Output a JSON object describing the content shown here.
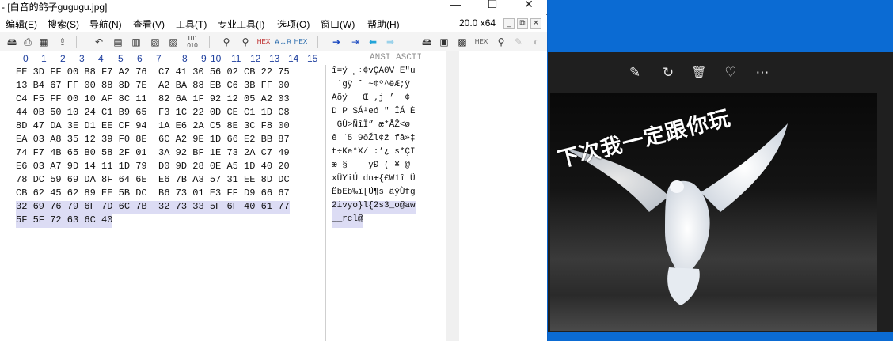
{
  "hexeditor": {
    "title": "- [白音的鸽子gugugu.jpg]",
    "window_buttons": [
      "—",
      "☐",
      "✕"
    ],
    "menu": [
      "编辑(E)",
      "搜索(S)",
      "导航(N)",
      "查看(V)",
      "工具(T)",
      "专业工具(I)",
      "选项(O)",
      "窗口(W)",
      "帮助(H)"
    ],
    "zoom": "20.0 x64",
    "mdi_buttons": [
      "_",
      "⧉",
      "✕"
    ],
    "column_headers": [
      "0",
      "1",
      "2",
      "3",
      "4",
      "5",
      "6",
      "7",
      "8",
      "9",
      "10",
      "11",
      "12",
      "13",
      "14",
      "15"
    ],
    "ansi_header": "ANSI ASCII",
    "hex_rows": [
      "EE 3D FF 00 B8 F7 A2 76  C7 41 30 56 02 CB 22 75",
      "13 B4 67 FF 00 88 8D 7E  A2 BA 88 EB C6 3B FF 00",
      "C4 F5 FF 00 10 AF 8C 11  82 6A 1F 92 12 05 A2 03",
      "44 0B 50 10 24 C1 B9 65  F3 1C 22 0D CE C1 1D C8",
      "8D 47 DA 3E D1 EE CF 94  1A E6 2A C5 8E 3C F8 00",
      "EA 03 A8 35 12 39 F0 8E  6C A2 9E 1D 66 E2 BB 87",
      "74 F7 4B 65 B0 58 2F 01  3A 92 BF 1E 73 2A C7 49",
      "E6 03 A7 9D 14 11 1D 79  D0 9D 28 0E A5 1D 40 20",
      "78 DC 59 69 DA 8F 64 6E  E6 7B A3 57 31 EE 8D DC",
      "CB 62 45 62 89 EE 5B DC  B6 73 01 E3 FF D9 66 67",
      "32 69 76 79 6F 7D 6C 7B  32 73 33 5F 6F 40 61 77",
      "5F 5F 72 63 6C 40"
    ],
    "ansi_rows": [
      "î=ÿ ¸÷¢vÇA0V Ë\"u",
      " ´gÿ ˆ ~¢º^ëÆ;ÿ",
      "Äõÿ  ¯Œ ‚j ’  ¢",
      "D P $Á¹eó \" ÎÁ È",
      " GÚ>ÑîÏ” æ*ÅŽ<ø",
      "ê ¨5 9ðŽl¢ž fâ»‡",
      "t÷Ke°X/ :’¿ s*ÇI",
      "æ §    yÐ ( ¥ @ ",
      "xÜYiÚ dnæ{£W1î Ü",
      "ËbEb‰î[Ü¶s ãÿÙfg",
      "2ivyo}l{2s3_o@aw",
      "__rcl@"
    ]
  },
  "photos": {
    "toolbar_icons": [
      "edit-icon",
      "rotate-icon",
      "delete-icon",
      "favorite-icon",
      "more-icon"
    ],
    "toolbar_glyphs": [
      "✎",
      "↻",
      "🗑",
      "♡",
      "⋯"
    ],
    "caption": "下次我一定跟你玩"
  }
}
